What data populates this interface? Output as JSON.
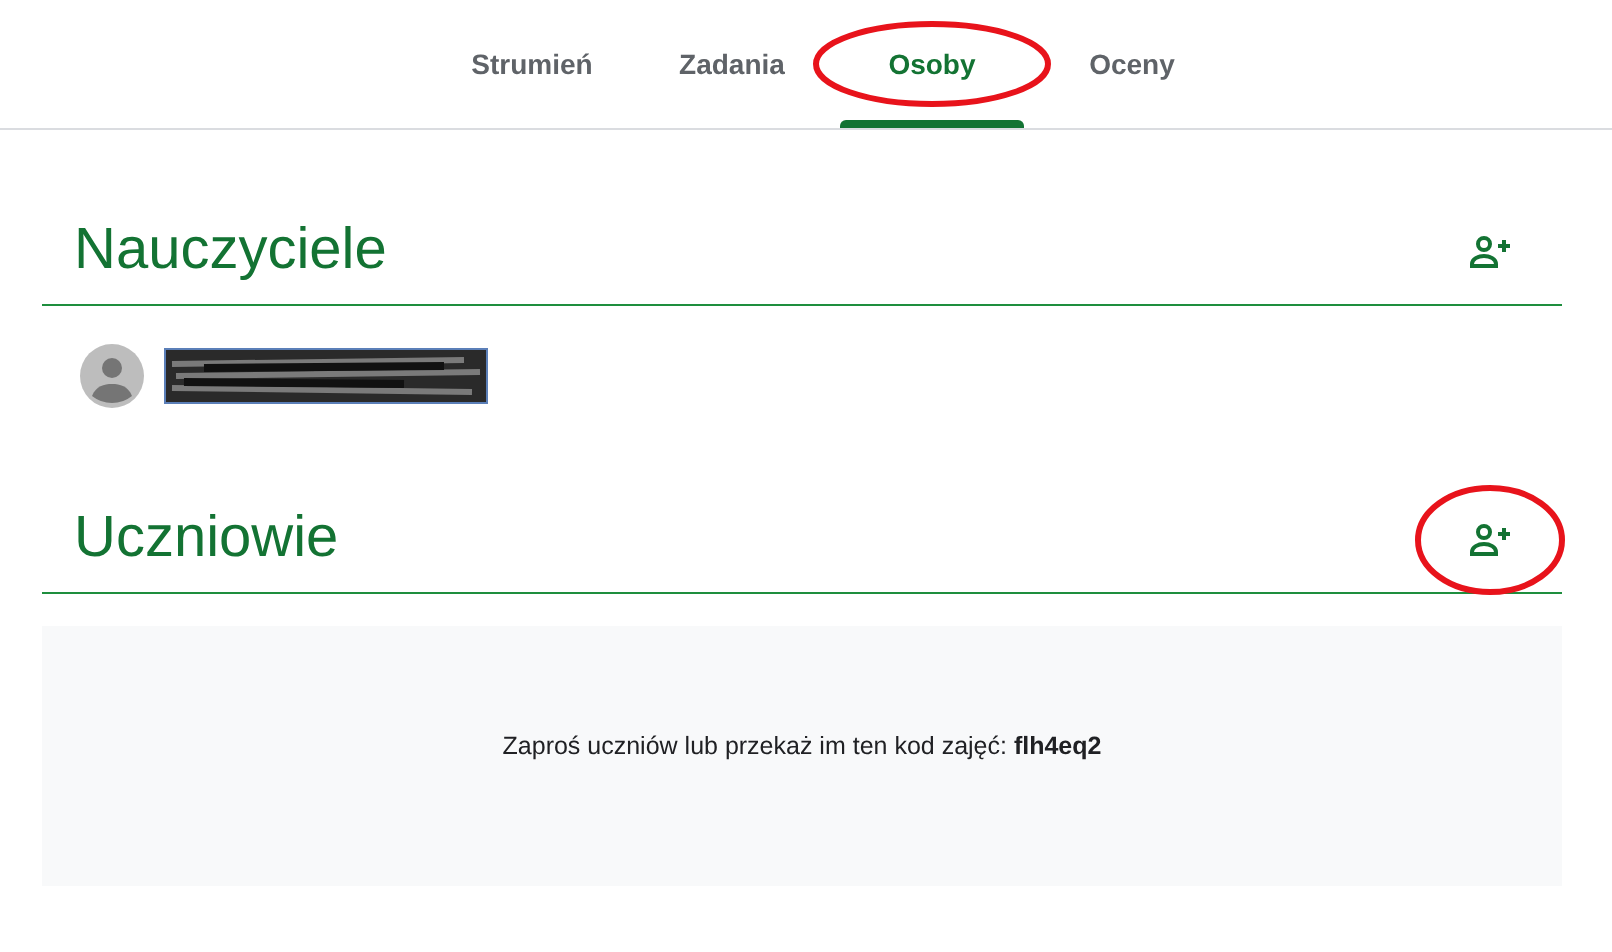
{
  "tabs": [
    {
      "label": "Strumień",
      "selected": false,
      "circled": false
    },
    {
      "label": "Zadania",
      "selected": false,
      "circled": false
    },
    {
      "label": "Osoby",
      "selected": true,
      "circled": true
    },
    {
      "label": "Oceny",
      "selected": false,
      "circled": false
    }
  ],
  "sections": [
    {
      "title": "Nauczyciele",
      "add_circled": false,
      "people": [
        {
          "kind": "redacted"
        }
      ]
    },
    {
      "title": "Uczniowie",
      "add_circled": true
    }
  ],
  "invite": {
    "text": "Zaproś uczniów lub przekaż im ten kod zajęć: ",
    "code": "flh4eq2"
  }
}
